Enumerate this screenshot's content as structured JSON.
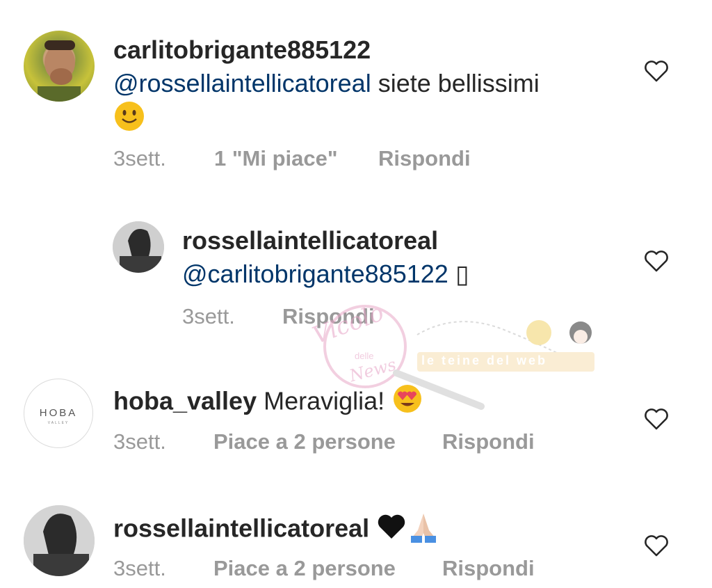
{
  "comments": [
    {
      "username": "carlitobrigante885122",
      "mention": "@rossellaintellicatoreal",
      "text": " siete bellissimi",
      "emoji_name": "smiling-face",
      "time": "3sett.",
      "likes": "1 \"Mi piace\"",
      "reply": "Rispondi"
    },
    {
      "username": "rossellaintellicatoreal",
      "mention": "@carlitobrigante885122",
      "text": " ▯",
      "time": "3sett.",
      "reply": "Rispondi"
    },
    {
      "username": "hoba_valley",
      "text": " Meraviglia!",
      "emoji_name": "heart-eyes-face",
      "avatar_text": "HOBA",
      "avatar_subtext": "VALLEY",
      "time": "3sett.",
      "likes": "Piace a 2 persone",
      "reply": "Rispondi"
    },
    {
      "username": "rossellaintellicatoreal",
      "text": " ",
      "emoji_names": [
        "black-heart",
        "folded-hands"
      ],
      "time": "3sett.",
      "likes": "Piace a 2 persone",
      "reply": "Rispondi"
    }
  ],
  "watermark": {
    "word1": "Vicolo",
    "word2": "delle",
    "word3": "News",
    "banner": "le teine del web"
  },
  "colors": {
    "mention": "#003569",
    "meta": "#999999",
    "text": "#262626"
  }
}
